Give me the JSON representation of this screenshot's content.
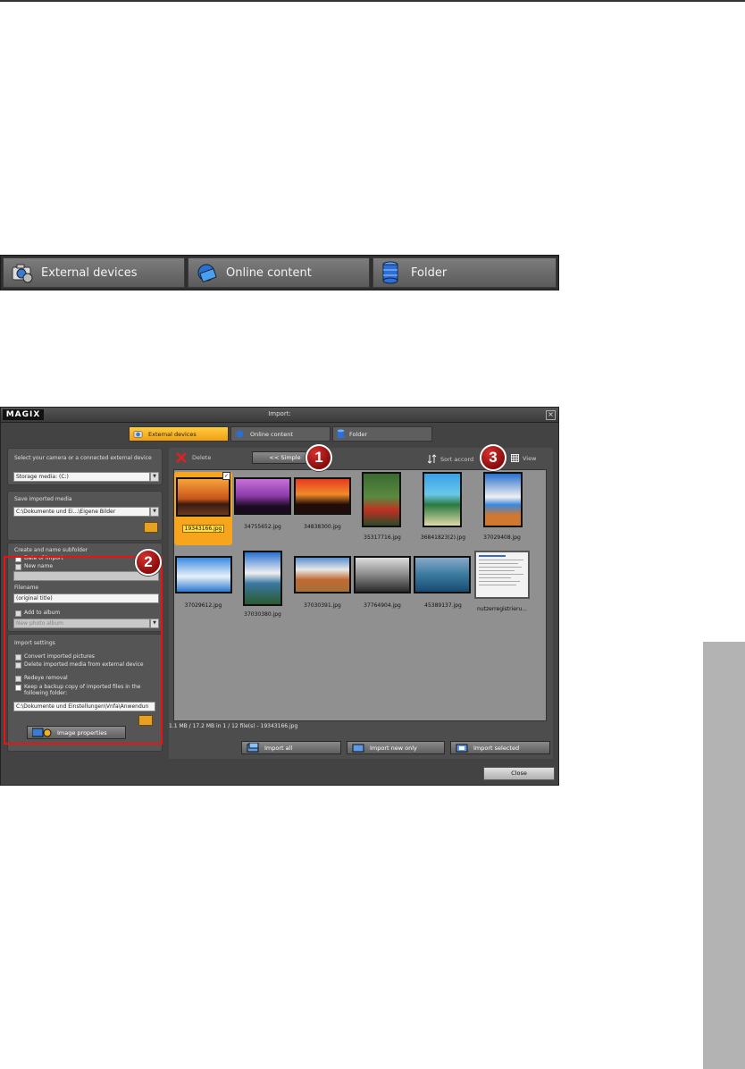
{
  "top_tabs": [
    {
      "label": "External devices",
      "icon": "camera-icon"
    },
    {
      "label": "Online content",
      "icon": "globe-icon"
    },
    {
      "label": "Folder",
      "icon": "database-icon"
    }
  ],
  "dialog": {
    "brand": "MAGIX",
    "title": "Import:",
    "close_glyph": "×",
    "tabs": [
      "External devices",
      "Online content",
      "Folder"
    ],
    "left": {
      "select_label": "Select your camera or a connected external device",
      "device_value": "Storage media: (C:)",
      "save_label": "Save imported media",
      "save_path": "C:\\Dokumente und Ei...\\Eigene Bilder",
      "subfolder_label": "Create and name subfolder",
      "date_of_import": "Date of import",
      "new_name": "New name",
      "filename_label": "Filename",
      "filename_value": "(original title)",
      "add_to_album": "Add to album",
      "album_placeholder": "New photo album",
      "import_settings_label": "Import settings",
      "convert": "Convert imported pictures",
      "delete_external": "Delete imported media from external device",
      "redeye": "Redeye removal",
      "backup": "Keep a backup copy of imported files in the following folder:",
      "backup_path": "C:\\Dokumente und Einstellungen\\Vnfa\\Anwendun",
      "image_properties": "Image properties"
    },
    "right": {
      "delete_label": "Delete",
      "simple_label": "<< Simple",
      "sort_label": "Sort accord",
      "view_label": "View",
      "thumbnails": [
        "19343166.jpg",
        "34755652.jpg",
        "34838300.jpg",
        "35317716.jpg",
        "36841823(2).jpg",
        "37029408.jpg",
        "37029612.jpg",
        "37030380.jpg",
        "37030391.jpg",
        "37764904.jpg",
        "45389137.jpg",
        "nutzerregistrieru..."
      ],
      "status": "1.1 MB / 17.2 MB in 1 / 12 file(s)  -  19343166.jpg",
      "import_all": "Import all",
      "import_new_only": "Import new only",
      "import_selected": "Import selected"
    },
    "close_label": "Close"
  },
  "callouts": [
    "1",
    "2",
    "3"
  ],
  "colors": {
    "accent": "#f7a51c",
    "callout": "#b01818",
    "highlight_border": "#e11111"
  }
}
